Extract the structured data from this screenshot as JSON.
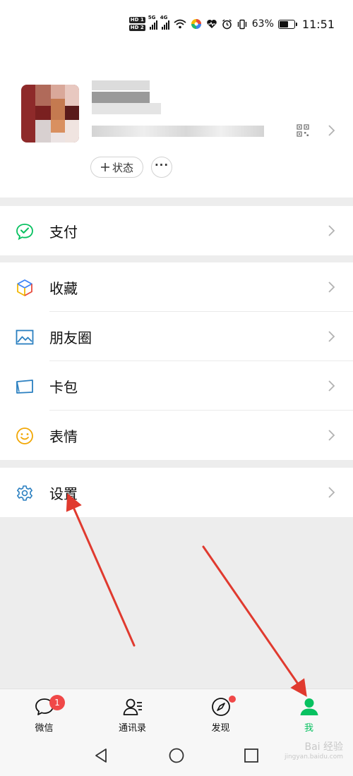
{
  "status_bar": {
    "hd_badges": [
      "HD 1",
      "HD 2"
    ],
    "network": "5G",
    "network2": "4G",
    "battery_percent": "63%",
    "battery_level": 0.63,
    "time": "11:51"
  },
  "profile": {
    "status_button": "状态",
    "more_button": "···"
  },
  "menu": {
    "pay": "支付",
    "favorites": "收藏",
    "moments": "朋友圈",
    "cards": "卡包",
    "stickers": "表情",
    "settings": "设置"
  },
  "tabbar": {
    "chats": "微信",
    "chats_badge": "1",
    "contacts": "通讯录",
    "discover": "发现",
    "me": "我"
  },
  "watermark": {
    "line1": "Bai 经验",
    "line2": "jingyan.baidu.com"
  },
  "colors": {
    "accent": "#07c160",
    "badge": "#f04848",
    "annotation": "#e03a2f"
  }
}
